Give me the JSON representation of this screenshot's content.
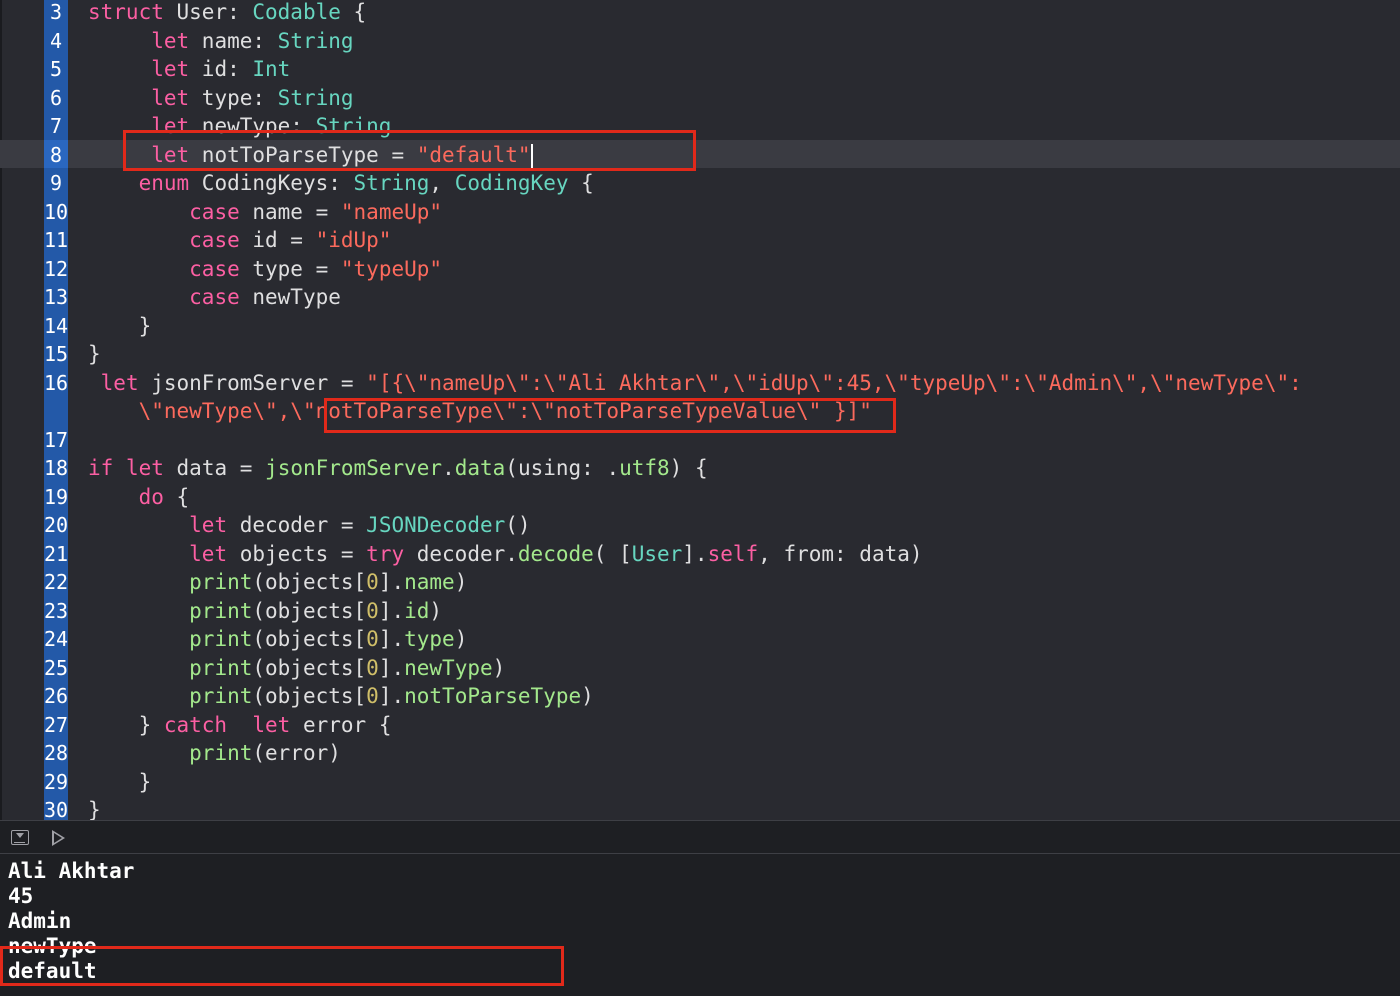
{
  "editor": {
    "lines": [
      {
        "num": "3",
        "segments": [
          {
            "t": "struct ",
            "c": "kw"
          },
          {
            "t": "User: "
          },
          {
            "t": "Codable",
            "c": "ty"
          },
          {
            "t": " {"
          }
        ]
      },
      {
        "num": "4",
        "segments": [
          {
            "t": "     "
          },
          {
            "t": "let",
            "c": "kw"
          },
          {
            "t": " name: "
          },
          {
            "t": "String",
            "c": "ty"
          }
        ]
      },
      {
        "num": "5",
        "segments": [
          {
            "t": "     "
          },
          {
            "t": "let",
            "c": "kw"
          },
          {
            "t": " id: "
          },
          {
            "t": "Int",
            "c": "ty"
          }
        ]
      },
      {
        "num": "6",
        "segments": [
          {
            "t": "     "
          },
          {
            "t": "let",
            "c": "kw"
          },
          {
            "t": " type: "
          },
          {
            "t": "String",
            "c": "ty"
          }
        ]
      },
      {
        "num": "7",
        "segments": [
          {
            "t": "     "
          },
          {
            "t": "let",
            "c": "kw"
          },
          {
            "t": " newType: "
          },
          {
            "t": "String",
            "c": "ty"
          }
        ]
      },
      {
        "num": "8",
        "segments": [
          {
            "t": "     "
          },
          {
            "t": "let",
            "c": "kw"
          },
          {
            "t": " notToParseType = "
          },
          {
            "t": "\"default\"",
            "c": "st"
          }
        ]
      },
      {
        "num": "9",
        "segments": [
          {
            "t": "    "
          },
          {
            "t": "enum",
            "c": "kw"
          },
          {
            "t": " CodingKeys: "
          },
          {
            "t": "String",
            "c": "ty"
          },
          {
            "t": ", "
          },
          {
            "t": "CodingKey",
            "c": "ty"
          },
          {
            "t": " {"
          }
        ]
      },
      {
        "num": "10",
        "segments": [
          {
            "t": "        "
          },
          {
            "t": "case",
            "c": "kw"
          },
          {
            "t": " name = "
          },
          {
            "t": "\"nameUp\"",
            "c": "st"
          }
        ]
      },
      {
        "num": "11",
        "segments": [
          {
            "t": "        "
          },
          {
            "t": "case",
            "c": "kw"
          },
          {
            "t": " id = "
          },
          {
            "t": "\"idUp\"",
            "c": "st"
          }
        ]
      },
      {
        "num": "12",
        "segments": [
          {
            "t": "        "
          },
          {
            "t": "case",
            "c": "kw"
          },
          {
            "t": " type = "
          },
          {
            "t": "\"typeUp\"",
            "c": "st"
          }
        ]
      },
      {
        "num": "13",
        "segments": [
          {
            "t": "        "
          },
          {
            "t": "case",
            "c": "kw"
          },
          {
            "t": " newType"
          }
        ]
      },
      {
        "num": "14",
        "segments": [
          {
            "t": "    }"
          }
        ]
      },
      {
        "num": "15",
        "segments": [
          {
            "t": "}"
          }
        ]
      },
      {
        "num": "16",
        "segments": [
          {
            "t": " "
          },
          {
            "t": "let",
            "c": "kw"
          },
          {
            "t": " jsonFromServer = "
          },
          {
            "t": "\"[{\\\"nameUp\\\":\\\"Ali Akhtar\\\",\\\"idUp\\\":45,\\\"typeUp\\\":\\\"Admin\\\",\\\"newType\\\":",
            "c": "st"
          }
        ]
      },
      {
        "num": "",
        "segments": [
          {
            "t": "    "
          },
          {
            "t": "\\\"newType\\\",\\\"notToParseType\\\":\\\"notToParseTypeValue\\\" }]\"",
            "c": "st"
          }
        ]
      },
      {
        "num": "17",
        "segments": []
      },
      {
        "num": "18",
        "segments": [
          {
            "t": "if",
            "c": "kw"
          },
          {
            "t": " "
          },
          {
            "t": "let",
            "c": "kw"
          },
          {
            "t": " data = "
          },
          {
            "t": "jsonFromServer",
            "c": "fn"
          },
          {
            "t": "."
          },
          {
            "t": "data",
            "c": "pr"
          },
          {
            "t": "(using: ."
          },
          {
            "t": "utf8",
            "c": "pr"
          },
          {
            "t": ") {"
          }
        ]
      },
      {
        "num": "19",
        "segments": [
          {
            "t": "    "
          },
          {
            "t": "do",
            "c": "kw"
          },
          {
            "t": " {"
          }
        ]
      },
      {
        "num": "20",
        "segments": [
          {
            "t": "        "
          },
          {
            "t": "let",
            "c": "kw"
          },
          {
            "t": " decoder = "
          },
          {
            "t": "JSONDecoder",
            "c": "ty"
          },
          {
            "t": "()"
          }
        ]
      },
      {
        "num": "21",
        "segments": [
          {
            "t": "        "
          },
          {
            "t": "let",
            "c": "kw"
          },
          {
            "t": " objects = "
          },
          {
            "t": "try",
            "c": "kw"
          },
          {
            "t": " decoder."
          },
          {
            "t": "decode",
            "c": "pr"
          },
          {
            "t": "( ["
          },
          {
            "t": "User",
            "c": "ty"
          },
          {
            "t": "]."
          },
          {
            "t": "self",
            "c": "kw"
          },
          {
            "t": ", from: data)"
          }
        ]
      },
      {
        "num": "22",
        "segments": [
          {
            "t": "        "
          },
          {
            "t": "print",
            "c": "pr"
          },
          {
            "t": "(objects["
          },
          {
            "t": "0",
            "c": "nm"
          },
          {
            "t": "]."
          },
          {
            "t": "name",
            "c": "pr"
          },
          {
            "t": ")"
          }
        ]
      },
      {
        "num": "23",
        "segments": [
          {
            "t": "        "
          },
          {
            "t": "print",
            "c": "pr"
          },
          {
            "t": "(objects["
          },
          {
            "t": "0",
            "c": "nm"
          },
          {
            "t": "]."
          },
          {
            "t": "id",
            "c": "pr"
          },
          {
            "t": ")"
          }
        ]
      },
      {
        "num": "24",
        "segments": [
          {
            "t": "        "
          },
          {
            "t": "print",
            "c": "pr"
          },
          {
            "t": "(objects["
          },
          {
            "t": "0",
            "c": "nm"
          },
          {
            "t": "]."
          },
          {
            "t": "type",
            "c": "pr"
          },
          {
            "t": ")"
          }
        ]
      },
      {
        "num": "25",
        "segments": [
          {
            "t": "        "
          },
          {
            "t": "print",
            "c": "pr"
          },
          {
            "t": "(objects["
          },
          {
            "t": "0",
            "c": "nm"
          },
          {
            "t": "]."
          },
          {
            "t": "newType",
            "c": "pr"
          },
          {
            "t": ")"
          }
        ]
      },
      {
        "num": "26",
        "segments": [
          {
            "t": "        "
          },
          {
            "t": "print",
            "c": "pr"
          },
          {
            "t": "(objects["
          },
          {
            "t": "0",
            "c": "nm"
          },
          {
            "t": "]."
          },
          {
            "t": "notToParseType",
            "c": "pr"
          },
          {
            "t": ")"
          }
        ]
      },
      {
        "num": "27",
        "segments": [
          {
            "t": "    } "
          },
          {
            "t": "catch",
            "c": "kw"
          },
          {
            "t": "  "
          },
          {
            "t": "let",
            "c": "kw"
          },
          {
            "t": " error {"
          }
        ]
      },
      {
        "num": "28",
        "segments": [
          {
            "t": "        "
          },
          {
            "t": "print",
            "c": "pr"
          },
          {
            "t": "(error)"
          }
        ]
      },
      {
        "num": "29",
        "segments": [
          {
            "t": "    }"
          }
        ]
      },
      {
        "num": "30",
        "segments": [
          {
            "t": "}"
          }
        ]
      }
    ]
  },
  "debug_bar": {
    "hide_icon": "hide-debug-area-icon",
    "run_icon": "play-icon"
  },
  "console": {
    "output": [
      "Ali Akhtar",
      "45",
      "Admin",
      "newType",
      "default"
    ]
  },
  "colors": {
    "keyword": "#fc5fa3",
    "type": "#67d6c0",
    "string": "#fc6a5d",
    "member": "#a3e88c",
    "number": "#d0bf69",
    "highlight_box": "#e1291a"
  }
}
